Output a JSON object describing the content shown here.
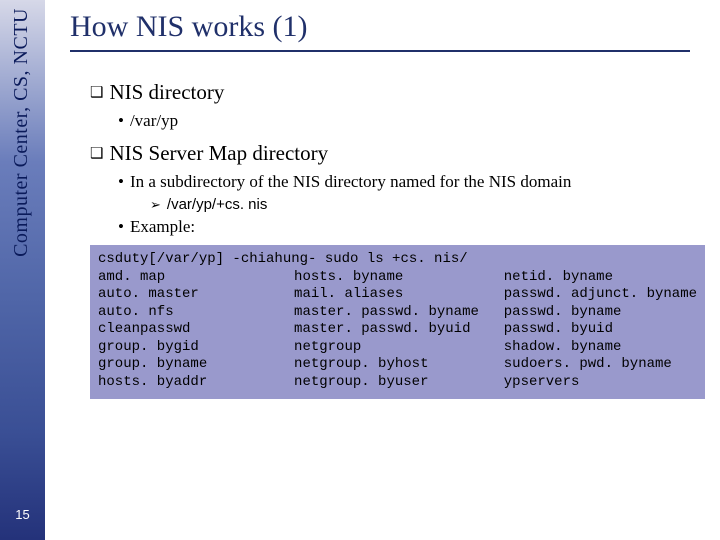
{
  "sidebar": {
    "label": "Computer Center, CS, NCTU",
    "page_number": "15"
  },
  "title": "How NIS works (1)",
  "bullets": {
    "b1": "NIS directory",
    "b1_1": "/var/yp",
    "b2": "NIS Server Map directory",
    "b2_1": "In a subdirectory of the NIS directory named for the NIS domain",
    "b2_1_1": "/var/yp/+cs. nis",
    "b2_2": "Example:"
  },
  "code": {
    "cmd": "csduty[/var/yp] -chiahung- sudo ls +cs. nis/",
    "col1": [
      "amd. map",
      "auto. master",
      "auto. nfs",
      "cleanpasswd",
      "group. bygid",
      "group. byname",
      "hosts. byaddr"
    ],
    "col2": [
      "hosts. byname",
      "mail. aliases",
      "master. passwd. byname",
      "master. passwd. byuid",
      "netgroup",
      "netgroup. byhost",
      "netgroup. byuser"
    ],
    "col3": [
      "netid. byname",
      "passwd. adjunct. byname",
      "passwd. byname",
      "passwd. byuid",
      "shadow. byname",
      "sudoers. pwd. byname",
      "ypservers"
    ]
  }
}
